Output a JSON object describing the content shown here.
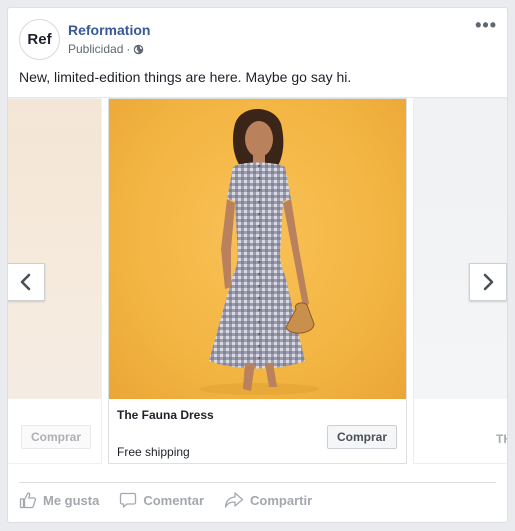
{
  "post": {
    "page_name": "Reformation",
    "avatar_text": "Ref",
    "sponsored_label": "Publicidad",
    "separator": "·",
    "caption": "New, limited-edition things are here. Maybe go say hi."
  },
  "carousel": {
    "cards": [
      {
        "position": "previous",
        "cta": "Comprar"
      },
      {
        "position": "current",
        "title": "The Fauna Dress",
        "subtitle": "Free shipping",
        "cta": "Comprar"
      },
      {
        "position": "next",
        "title_fragment": "TH"
      }
    ],
    "prev_icon": "chevron-left-icon",
    "next_icon": "chevron-right-icon"
  },
  "actions": {
    "like": "Me gusta",
    "comment": "Comentar",
    "share": "Compartir"
  },
  "colors": {
    "page_name": "#385898",
    "photo_background": "#f3b542",
    "muted_text": "#606770",
    "action_text": "#a3a7ae"
  }
}
